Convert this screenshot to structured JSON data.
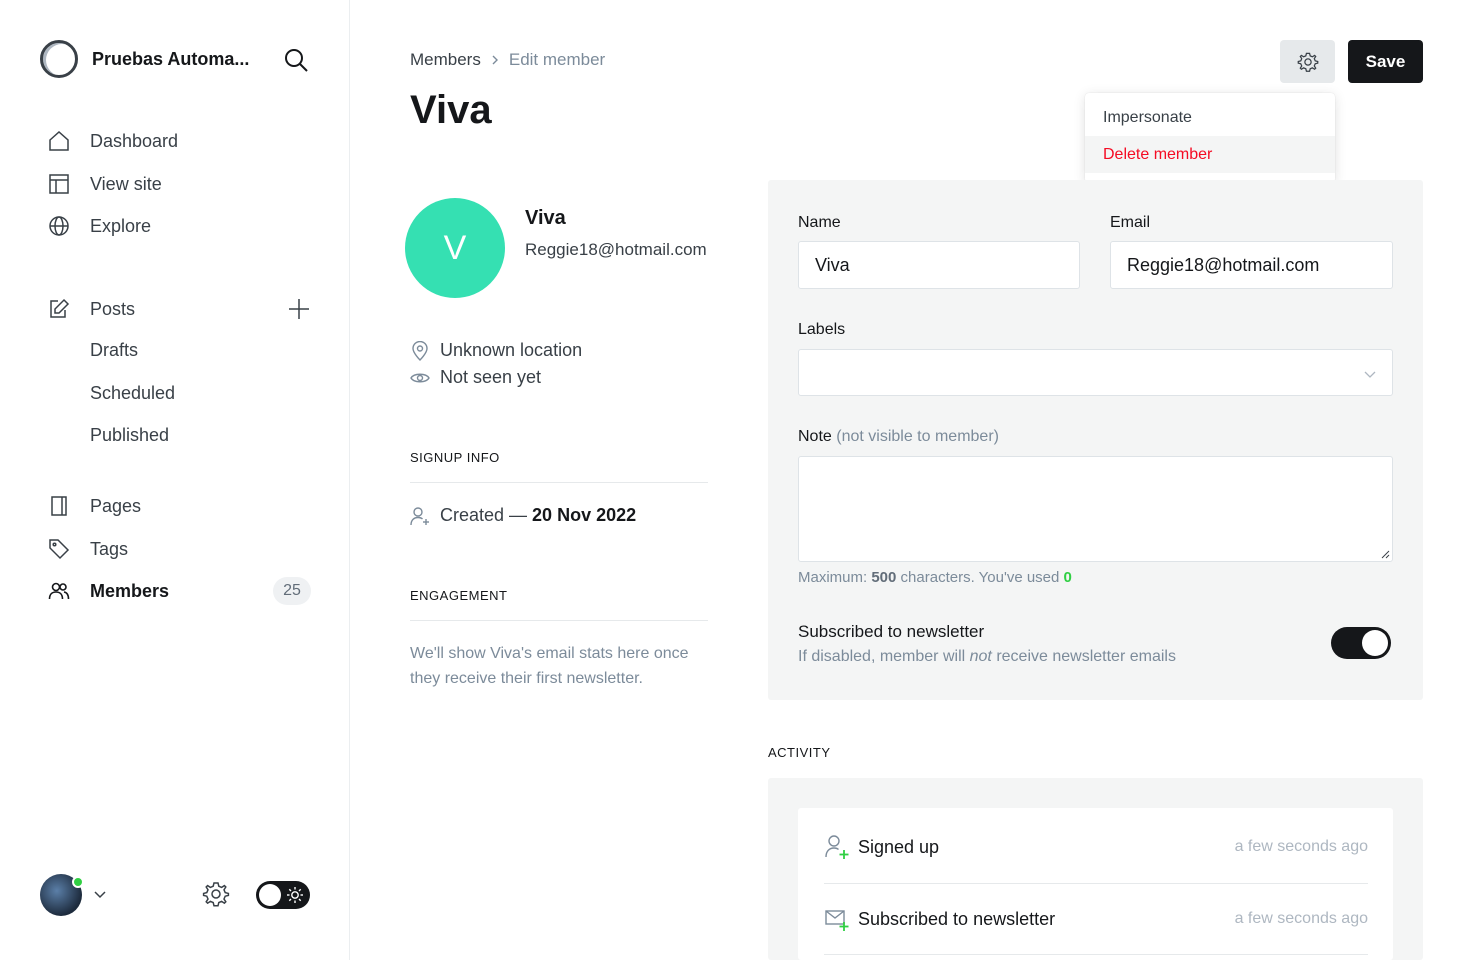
{
  "sidebar": {
    "site_name": "Pruebas Automa...",
    "nav": {
      "dashboard": "Dashboard",
      "view_site": "View site",
      "explore": "Explore",
      "posts": "Posts",
      "drafts": "Drafts",
      "scheduled": "Scheduled",
      "published": "Published",
      "pages": "Pages",
      "tags": "Tags",
      "members": "Members",
      "members_count": "25"
    }
  },
  "header": {
    "breadcrumb_parent": "Members",
    "breadcrumb_current": "Edit member",
    "title": "Viva",
    "save_label": "Save"
  },
  "actions_menu": {
    "items": [
      "Impersonate",
      "Delete member"
    ]
  },
  "member": {
    "initial": "V",
    "name": "Viva",
    "email": "Reggie18@hotmail.com",
    "location": "Unknown location",
    "last_seen": "Not seen yet",
    "signup_info_heading": "SIGNUP INFO",
    "created_label": "Created —",
    "created_date": "20 Nov 2022",
    "engagement_heading": "ENGAGEMENT",
    "engagement_text": "We'll show Viva's email stats here once they receive their first newsletter."
  },
  "form": {
    "name_label": "Name",
    "name_value": "Viva",
    "email_label": "Email",
    "email_value": "Reggie18@hotmail.com",
    "labels_label": "Labels",
    "note_label": "Note",
    "note_muted": "(not visible to member)",
    "hint_prefix": "Maximum:",
    "hint_max": "500",
    "hint_middle": "characters. You've used",
    "hint_used": "0",
    "newsletter_title": "Subscribed to newsletter",
    "newsletter_desc_before": "If disabled, member will",
    "newsletter_desc_em": "not",
    "newsletter_desc_after": "receive newsletter emails",
    "newsletter_subscribed": true
  },
  "activity": {
    "heading": "ACTIVITY",
    "items": [
      {
        "text": "Signed up",
        "time": "a few seconds ago",
        "icon": "user-add-icon"
      },
      {
        "text": "Subscribed to newsletter",
        "time": "a few seconds ago",
        "icon": "mail-add-icon"
      }
    ]
  },
  "colors": {
    "avatar_bg": "#35e0b2",
    "danger": "#f50b23",
    "success": "#30cf43",
    "primary_button": "#15171a"
  }
}
